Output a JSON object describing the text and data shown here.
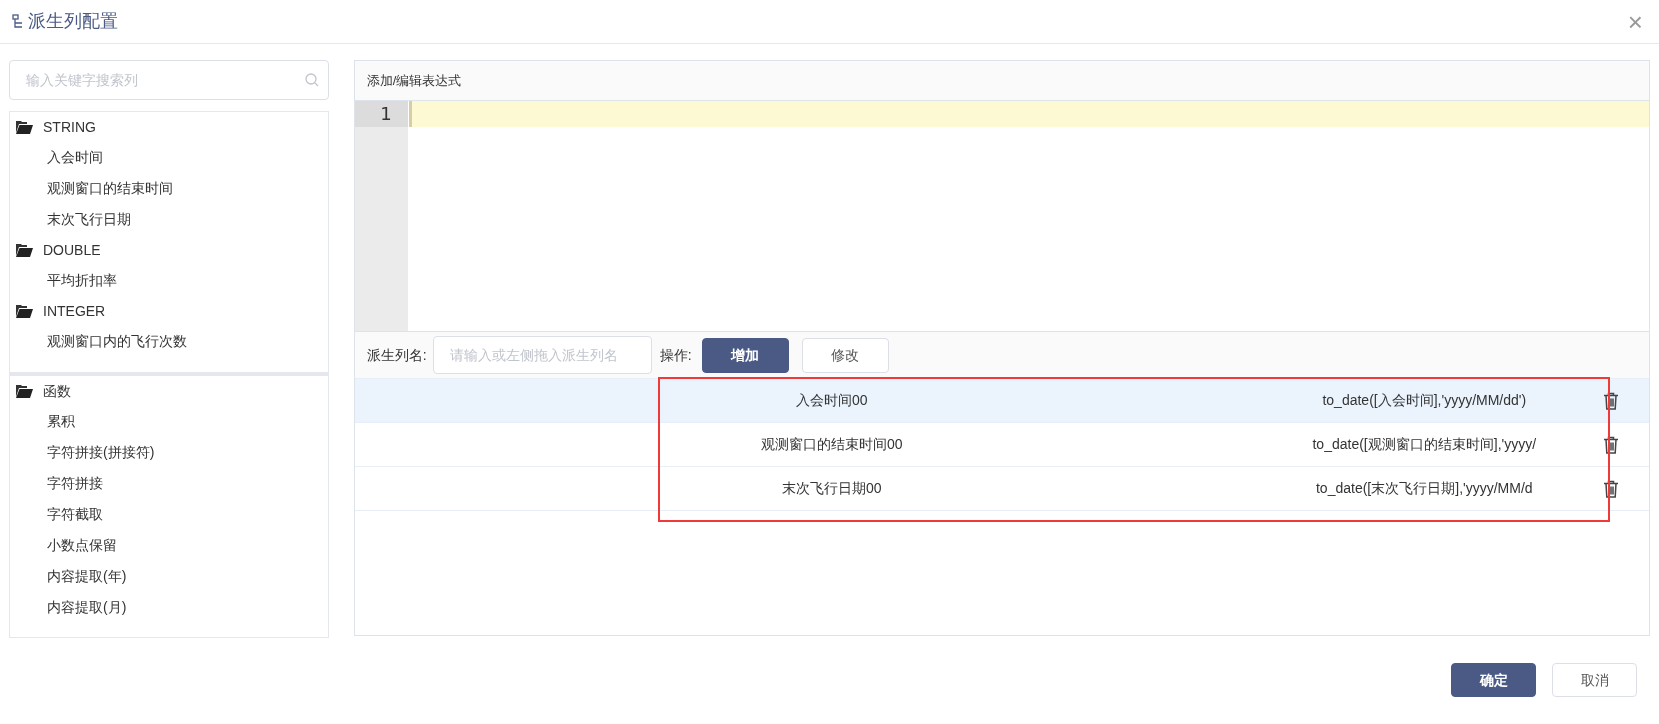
{
  "dialog": {
    "title": "派生列配置",
    "close": "×"
  },
  "search": {
    "placeholder": "输入关键字搜索列"
  },
  "tree_sections": [
    {
      "groups": [
        {
          "label": "STRING",
          "children": [
            {
              "label": "入会时间"
            },
            {
              "label": "观测窗口的结束时间"
            },
            {
              "label": "末次飞行日期"
            }
          ]
        },
        {
          "label": "DOUBLE",
          "children": [
            {
              "label": "平均折扣率"
            }
          ]
        },
        {
          "label": "INTEGER",
          "children": [
            {
              "label": "观测窗口内的飞行次数"
            }
          ]
        }
      ]
    },
    {
      "groups": [
        {
          "label": "函数",
          "children": [
            {
              "label": "累积"
            },
            {
              "label": "字符拼接(拼接符)"
            },
            {
              "label": "字符拼接"
            },
            {
              "label": "字符截取"
            },
            {
              "label": "小数点保留"
            },
            {
              "label": "内容提取(年)"
            },
            {
              "label": "内容提取(月)"
            }
          ]
        }
      ]
    }
  ],
  "editor": {
    "header": "添加/编辑表达式",
    "line_numbers": [
      "1"
    ]
  },
  "form": {
    "label": "派生列名:",
    "placeholder": "请输入或左侧拖入派生列名",
    "operation_label": "操作:",
    "buttons": [
      {
        "label": "增加",
        "kind": "primary"
      },
      {
        "label": "修改",
        "kind": "default"
      }
    ]
  },
  "rows": [
    {
      "name": "入会时间00",
      "expression": "to_date([入会时间],'yyyy/MM/dd')",
      "selected": true
    },
    {
      "name": "观测窗口的结束时间00",
      "expression": "to_date([观测窗口的结束时间],'yyyy/",
      "selected": false
    },
    {
      "name": "末次飞行日期00",
      "expression": "to_date([末次飞行日期],'yyyy/MM/d",
      "selected": false
    }
  ],
  "footer": {
    "buttons": [
      {
        "label": "确定",
        "kind": "primary"
      },
      {
        "label": "取消",
        "kind": "default"
      }
    ]
  }
}
